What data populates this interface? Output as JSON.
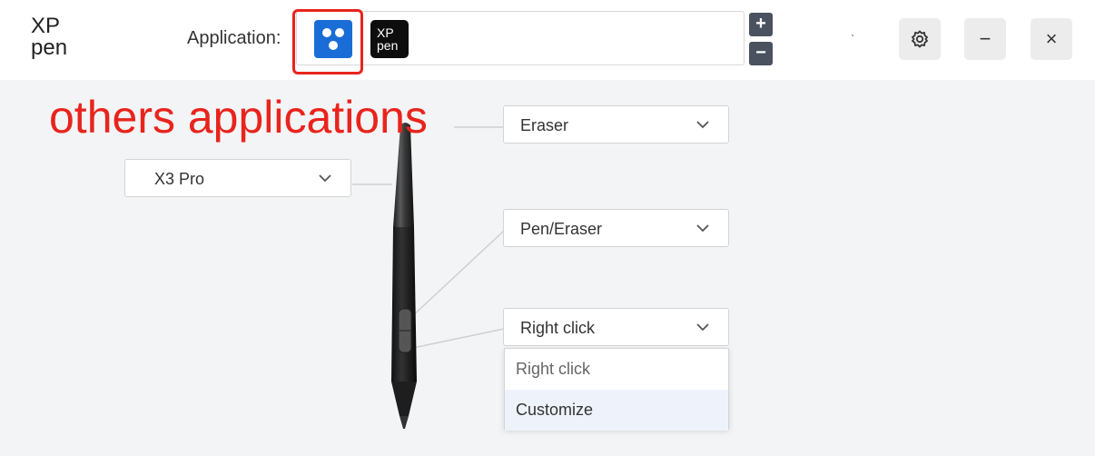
{
  "header": {
    "logo_text_top": "XP",
    "logo_text_bottom": "pen",
    "application_label": "Application:",
    "apps": [
      {
        "name": "others-applications-icon",
        "color": "#1a6dd6"
      },
      {
        "name": "xppen-app-icon",
        "color": "#0d0d0d",
        "text_top": "XP",
        "text_bottom": "pen"
      }
    ],
    "add_symbol": "+",
    "remove_symbol": "−",
    "minimize_symbol": "−",
    "close_symbol": "×"
  },
  "annotation": {
    "text": "others applications",
    "color": "#e8241c"
  },
  "device": {
    "selected": "X3 Pro"
  },
  "pen_buttons": [
    {
      "id": "top",
      "value": "Eraser"
    },
    {
      "id": "upper",
      "value": "Pen/Eraser"
    },
    {
      "id": "lower",
      "value": "Right click"
    }
  ],
  "dropdown_menu": {
    "options": [
      "Right click",
      "Customize"
    ],
    "hovered": "Customize"
  }
}
